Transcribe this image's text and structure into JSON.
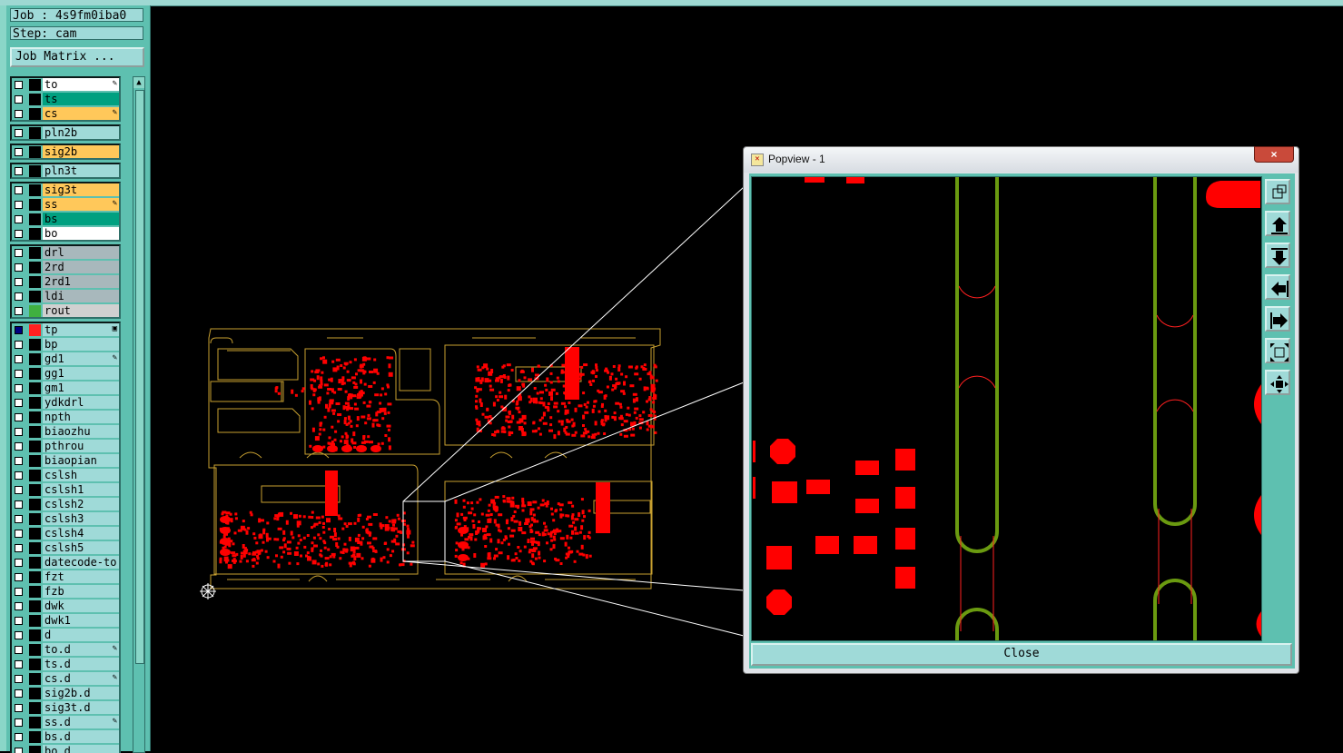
{
  "job": {
    "job_line": "Job : 4s9fm0iba0",
    "step_line": "Step: cam",
    "matrix_button": "Job Matrix ..."
  },
  "layer_groups": [
    [
      {
        "name": "to",
        "color": "#ffffff",
        "flag": "✎"
      },
      {
        "name": "ts",
        "color": "#00a080",
        "flag": ""
      },
      {
        "name": "cs",
        "color": "#ffc85a",
        "flag": "✎"
      }
    ],
    [
      {
        "name": "pln2b",
        "color": "#9fdad8",
        "flag": ""
      }
    ],
    [
      {
        "name": "sig2b",
        "color": "#ffc85a",
        "flag": ""
      }
    ],
    [
      {
        "name": "pln3t",
        "color": "#9fdad8",
        "flag": ""
      }
    ],
    [
      {
        "name": "sig3t",
        "color": "#ffc85a",
        "flag": ""
      },
      {
        "name": "ss",
        "color": "#ffc85a",
        "flag": "✎"
      },
      {
        "name": "bs",
        "color": "#00a080",
        "flag": ""
      },
      {
        "name": "bo",
        "color": "#ffffff",
        "flag": ""
      }
    ],
    [
      {
        "name": "drl",
        "color": "#a8b8bc",
        "flag": ""
      },
      {
        "name": "2rd",
        "color": "#a8b8bc",
        "flag": ""
      },
      {
        "name": "2rd1",
        "color": "#a8b8bc",
        "flag": ""
      },
      {
        "name": "ldi",
        "color": "#a8b8bc",
        "flag": ""
      },
      {
        "name": "rout",
        "color": "#d0d0d0",
        "flag": ""
      }
    ],
    [
      {
        "name": "tp",
        "color": "#9fdad8",
        "flag": "▣"
      },
      {
        "name": "bp",
        "color": "#9fdad8",
        "flag": ""
      },
      {
        "name": "gd1",
        "color": "#9fdad8",
        "flag": "✎"
      },
      {
        "name": "gg1",
        "color": "#9fdad8",
        "flag": ""
      },
      {
        "name": "gm1",
        "color": "#9fdad8",
        "flag": ""
      },
      {
        "name": "ydkdrl",
        "color": "#9fdad8",
        "flag": ""
      },
      {
        "name": "npth",
        "color": "#9fdad8",
        "flag": ""
      },
      {
        "name": "biaozhu",
        "color": "#9fdad8",
        "flag": ""
      },
      {
        "name": "pthrou",
        "color": "#9fdad8",
        "flag": ""
      },
      {
        "name": "biaopian",
        "color": "#9fdad8",
        "flag": ""
      },
      {
        "name": "cslsh",
        "color": "#9fdad8",
        "flag": ""
      },
      {
        "name": "cslsh1",
        "color": "#9fdad8",
        "flag": ""
      },
      {
        "name": "cslsh2",
        "color": "#9fdad8",
        "flag": ""
      },
      {
        "name": "cslsh3",
        "color": "#9fdad8",
        "flag": ""
      },
      {
        "name": "cslsh4",
        "color": "#9fdad8",
        "flag": ""
      },
      {
        "name": "cslsh5",
        "color": "#9fdad8",
        "flag": ""
      },
      {
        "name": "datecode-to",
        "color": "#9fdad8",
        "flag": ""
      },
      {
        "name": "fzt",
        "color": "#9fdad8",
        "flag": ""
      },
      {
        "name": "fzb",
        "color": "#9fdad8",
        "flag": ""
      },
      {
        "name": "dwk",
        "color": "#9fdad8",
        "flag": ""
      },
      {
        "name": "dwk1",
        "color": "#9fdad8",
        "flag": ""
      },
      {
        "name": "d",
        "color": "#9fdad8",
        "flag": ""
      },
      {
        "name": "to.d",
        "color": "#9fdad8",
        "flag": "✎"
      },
      {
        "name": "ts.d",
        "color": "#9fdad8",
        "flag": ""
      },
      {
        "name": "cs.d",
        "color": "#9fdad8",
        "flag": "✎"
      },
      {
        "name": "sig2b.d",
        "color": "#9fdad8",
        "flag": ""
      },
      {
        "name": "sig3t.d",
        "color": "#9fdad8",
        "flag": ""
      },
      {
        "name": "ss.d",
        "color": "#9fdad8",
        "flag": "✎"
      },
      {
        "name": "bs.d",
        "color": "#9fdad8",
        "flag": ""
      },
      {
        "name": "bo.d",
        "color": "#9fdad8",
        "flag": ""
      }
    ]
  ],
  "active_layer": {
    "name": "tp",
    "swatch": "#ff2020",
    "check": "#000080"
  },
  "rout_swatch": "#40b040",
  "popview": {
    "title": "Popview - 1",
    "close_x": "×",
    "close_button": "Close",
    "tools": [
      "zoom-home-icon",
      "pan-up-icon",
      "pan-down-icon",
      "pan-left-icon",
      "pan-right-icon",
      "zoom-out-icon",
      "zoom-in-icon"
    ]
  },
  "colors": {
    "pcb_outline": "#c8a030",
    "pad": "#ff0000",
    "slot": "#6a9a10",
    "zoom_lines": "#ffffff"
  }
}
